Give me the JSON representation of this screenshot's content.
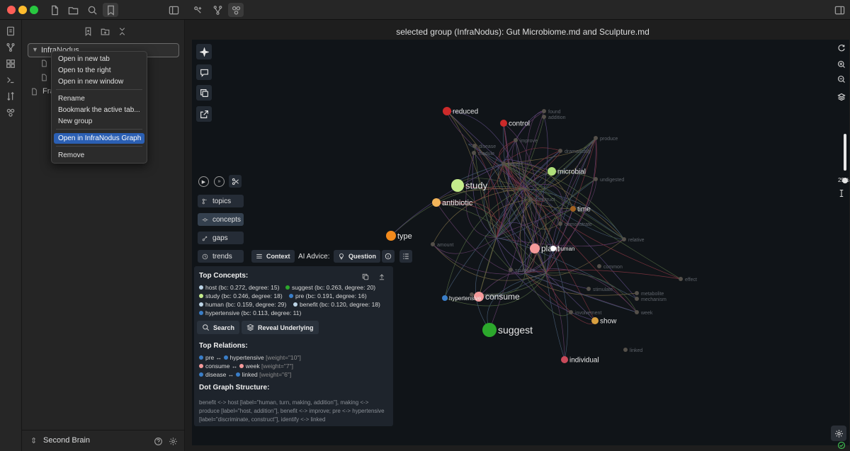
{
  "titlebar": {
    "traffic_colors": [
      "#ff5f57",
      "#febc2e",
      "#28c840"
    ],
    "left_icons": [
      "new-file-icon",
      "folder-icon",
      "search-icon",
      "bookmark-icon",
      "sidebar-toggle-icon"
    ],
    "center_icons": [
      "infranodus-graph-icon",
      "branch-icon",
      "nodes-icon"
    ]
  },
  "ribbon": {
    "icons": [
      "open-note-icon",
      "graph-view-icon",
      "grid-icon",
      "terminal-icon",
      "sort-icon",
      "infranodus-icon"
    ]
  },
  "sidebar": {
    "group_label": "InfraNodus",
    "files": [
      "",
      ""
    ],
    "folder_label": "Fra",
    "vault_name": "Second Brain"
  },
  "context_menu": {
    "items": [
      "Open in new tab",
      "Open to the right",
      "Open in new window",
      "Rename",
      "Bookmark the active tab...",
      "New group",
      "Open in InfraNodus Graph",
      "Remove"
    ],
    "highlighted": "Open in InfraNodus Graph"
  },
  "main": {
    "tab_title": "selected group (InfraNodus): Gut Microbiome.md and Sculpture.md"
  },
  "graph": {
    "side_buttons": [
      "sparkle-icon",
      "chat-icon",
      "copy-icon",
      "export-icon"
    ],
    "view_pills": [
      "topics",
      "concepts",
      "gaps",
      "trends"
    ],
    "selected_pill": "concepts",
    "context_label": "Context",
    "ai_advice_label": "AI Advice:",
    "question_label": "Question",
    "zoom_percent": "29%",
    "nodes": [
      {
        "label": "reduced",
        "color": "#cc2a2a"
      },
      {
        "label": "control",
        "color": "#cc2a2a"
      },
      {
        "label": "study",
        "color": "#c5ec8c"
      },
      {
        "label": "microbial",
        "color": "#b0e07a"
      },
      {
        "label": "antibiotic",
        "color": "#f2b45a"
      },
      {
        "label": "type",
        "color": "#f28a1c"
      },
      {
        "label": "plant",
        "color": "#f59a9a"
      },
      {
        "label": "human",
        "color": "#ffffff"
      },
      {
        "label": "consume",
        "color": "#f59a9a"
      },
      {
        "label": "suggest",
        "color": "#2ca82c"
      },
      {
        "label": "show",
        "color": "#d9a040"
      },
      {
        "label": "individual",
        "color": "#c94a5a"
      },
      {
        "label": "time",
        "color": "#a06020"
      },
      {
        "label": "hypertensive",
        "color": "#3a7ec8"
      }
    ],
    "faint_labels": [
      "found",
      "addition",
      "produce",
      "dramatically",
      "improve",
      "undigested",
      "benefit",
      "module",
      "disease",
      "demonstrate",
      "relative",
      "common",
      "effect",
      "stimulate",
      "metabolite",
      "mechanism",
      "week",
      "involvement",
      "amount",
      "sculpture",
      "discriminate",
      "construct",
      "linked"
    ]
  },
  "panel": {
    "top_concepts_title": "Top Concepts:",
    "top_concepts": [
      {
        "text": "host (bc: 0.272, degree: 15)",
        "color": "#bcd4e6"
      },
      {
        "text": "suggest (bc: 0.263, degree: 20)",
        "color": "#2ca82c"
      },
      {
        "text": "study (bc: 0.246, degree: 18)",
        "color": "#c5ec8c"
      },
      {
        "text": "pre (bc: 0.191, degree: 16)",
        "color": "#3a7ec8"
      },
      {
        "text": "human (bc: 0.159, degree: 29)",
        "color": "#bcd4e6"
      },
      {
        "text": "benefit (bc: 0.120, degree: 18)",
        "color": "#bcd4e6"
      },
      {
        "text": "hypertensive (bc: 0.113, degree: 11)",
        "color": "#3a7ec8"
      }
    ],
    "search_label": "Search",
    "reveal_label": "Reveal Underlying",
    "top_relations_title": "Top Relations:",
    "relations": [
      {
        "a": "pre",
        "ca": "#3a7ec8",
        "b": "hypertensive",
        "cb": "#3a7ec8",
        "w": "[weight=\"10\"]"
      },
      {
        "a": "consume",
        "ca": "#f59a9a",
        "b": "week",
        "cb": "#f59a9a",
        "w": "[weight=\"7\"]"
      },
      {
        "a": "disease",
        "ca": "#3a7ec8",
        "b": "linked",
        "cb": "#3a7ec8",
        "w": "[weight=\"6\"]"
      }
    ],
    "relation_arrow": "↔",
    "dot_title": "Dot Graph Structure:",
    "dot_text": "benefit <-> host [label=\"human, turn, making, addition\"], making <-> produce [label=\"host, addition\"], benefit <-> improve; pre <-> hypertensive [label=\"discriminate, construct\"], identify <-> linked"
  }
}
